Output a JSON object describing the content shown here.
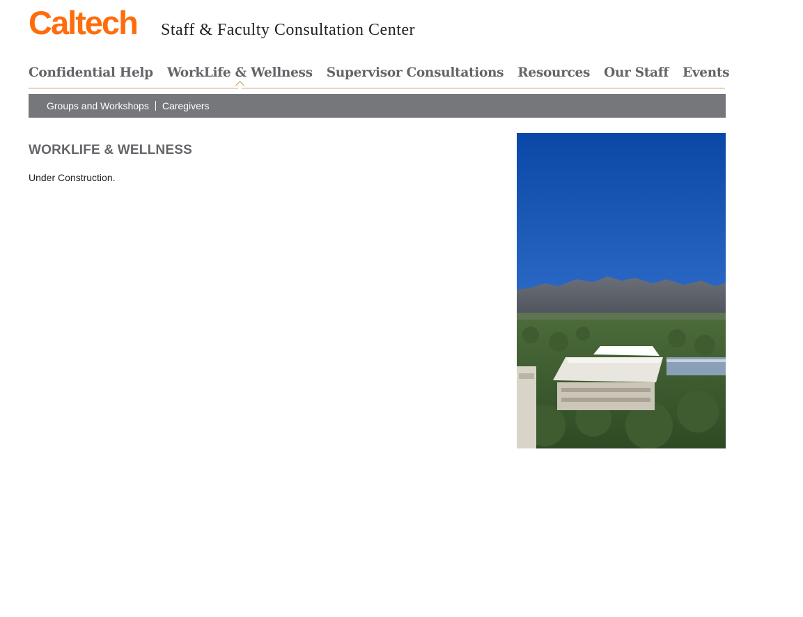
{
  "header": {
    "logo_text": "Caltech",
    "site_title": "Staff & Faculty Consultation Center",
    "brand_color": "#ff6c0c"
  },
  "main_nav": {
    "items": [
      {
        "label": "Confidential Help",
        "active": false
      },
      {
        "label": "WorkLife & Wellness",
        "active": true
      },
      {
        "label": "Supervisor Consultations",
        "active": false
      },
      {
        "label": "Resources",
        "active": false
      },
      {
        "label": "Our Staff",
        "active": false
      },
      {
        "label": "Events",
        "active": false
      }
    ]
  },
  "sub_nav": {
    "items": [
      {
        "label": "Groups and Workshops"
      },
      {
        "label": "Caregivers"
      }
    ],
    "background_color": "#76777b"
  },
  "content": {
    "heading": "WORKLIFE & WELLNESS",
    "body": "Under Construction."
  },
  "sidebar_image": {
    "description_icon": "campus-photo"
  }
}
